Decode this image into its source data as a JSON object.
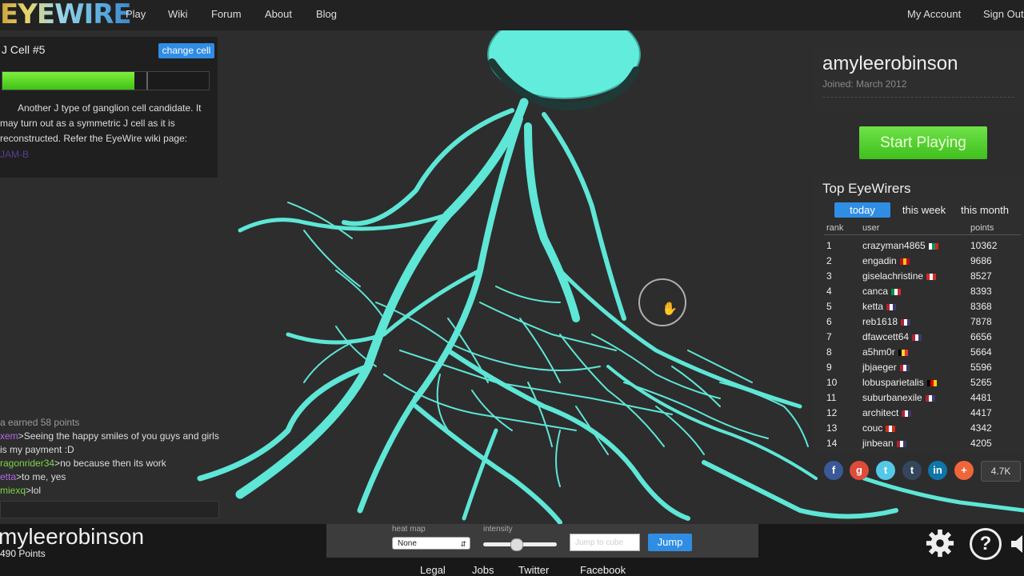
{
  "nav": {
    "logo": "EYEWIRE",
    "links": [
      "Play",
      "Wiki",
      "Forum",
      "About",
      "Blog"
    ],
    "account": "My Account",
    "signout": "Sign Out"
  },
  "cell": {
    "title": "J Cell #5",
    "change_label": "change cell",
    "progress": 0.64,
    "description": "Another J type of ganglion cell candidate. It may turn out as a symmetric J cell as it is reconstructed. Refer the EyeWire wiki page:",
    "link_text": "JAM-B"
  },
  "chat": {
    "system": "a earned 58 points",
    "messages": [
      {
        "user": "xem",
        "text": "Seeing the happy smiles of you guys and girls is my payment :D"
      },
      {
        "user": "ragonrider34",
        "text": "no because then its work"
      },
      {
        "user": "etta",
        "text": "to me, yes"
      },
      {
        "user": "miexq",
        "text": "lol"
      }
    ]
  },
  "profile": {
    "username": "amyleerobinson",
    "joined": "Joined: March 2012",
    "start_label": "Start Playing"
  },
  "leaderboard": {
    "title": "Top EyeWirers",
    "tabs": [
      "today",
      "this week",
      "this month"
    ],
    "active_tab": "today",
    "headers": [
      "rank",
      "user",
      "points"
    ],
    "rows": [
      {
        "rank": "1",
        "user": "crazyman4865",
        "points": "10362",
        "flag": "bg"
      },
      {
        "rank": "2",
        "user": "engadin",
        "points": "9686",
        "flag": "es"
      },
      {
        "rank": "3",
        "user": "giselachristine",
        "points": "8527",
        "flag": "ch"
      },
      {
        "rank": "4",
        "user": "canca",
        "points": "8393",
        "flag": "it"
      },
      {
        "rank": "5",
        "user": "ketta",
        "points": "8368",
        "flag": "us"
      },
      {
        "rank": "6",
        "user": "reb1618",
        "points": "7878",
        "flag": "us"
      },
      {
        "rank": "7",
        "user": "dfawcett64",
        "points": "6656",
        "flag": "us"
      },
      {
        "rank": "8",
        "user": "a5hm0r",
        "points": "5664",
        "flag": "be"
      },
      {
        "rank": "9",
        "user": "jbjaeger",
        "points": "5596",
        "flag": "us"
      },
      {
        "rank": "10",
        "user": "lobusparietalis",
        "points": "5265",
        "flag": "de"
      },
      {
        "rank": "11",
        "user": "suburbanexile",
        "points": "4481",
        "flag": "us"
      },
      {
        "rank": "12",
        "user": "architect",
        "points": "4417",
        "flag": "us"
      },
      {
        "rank": "13",
        "user": "couc",
        "points": "4342",
        "flag": "ca"
      },
      {
        "rank": "14",
        "user": "jinbean",
        "points": "4205",
        "flag": "us"
      }
    ]
  },
  "share": {
    "icons": [
      "facebook-icon",
      "google-plus-icon",
      "twitter-icon",
      "tumblr-icon",
      "linkedin-icon",
      "more-share-icon"
    ],
    "count": "4.7K"
  },
  "bottom": {
    "username": "myleerobinson",
    "points": "490 Points",
    "heatmap_label": "heat map",
    "heatmap_value": "None",
    "intensity_label": "intensity",
    "intensity_value": 0.45,
    "jump_placeholder": "Jump to cube",
    "jump_label": "Jump"
  },
  "footer": [
    "Legal",
    "Jobs",
    "Twitter",
    "Facebook"
  ],
  "colors": {
    "accent_blue": "#2f8de4",
    "green": "#4fd12a",
    "neuron": "#5ee6d6"
  }
}
